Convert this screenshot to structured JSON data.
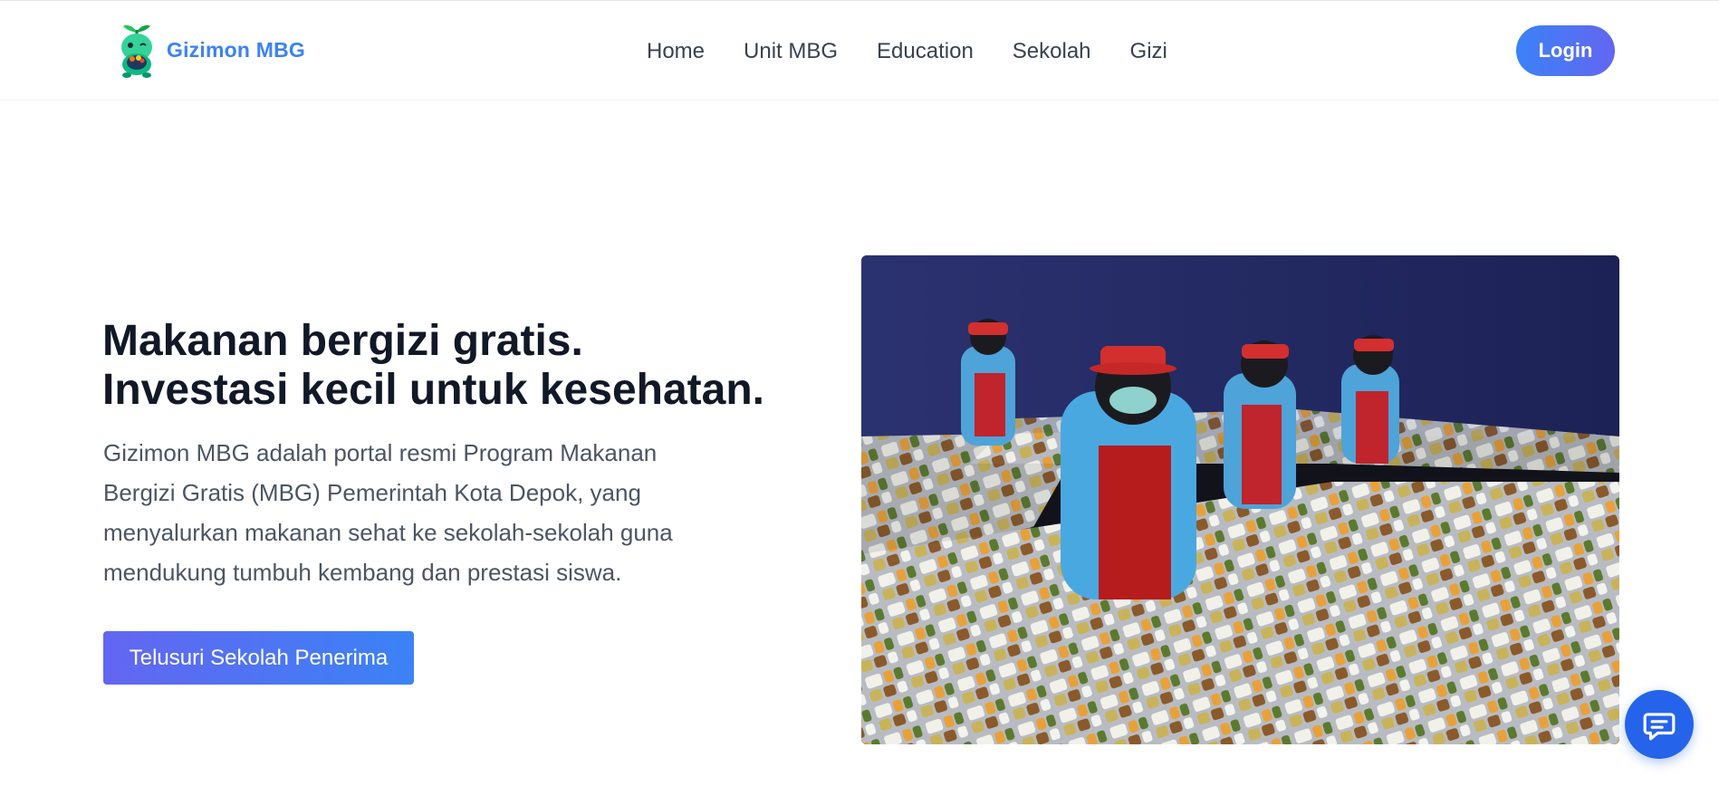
{
  "brand": {
    "name": "Gizimon MBG",
    "logo_icon": "gizimon-mascot-icon"
  },
  "nav": {
    "items": [
      "Home",
      "Unit MBG",
      "Education",
      "Sekolah",
      "Gizi"
    ],
    "login_label": "Login"
  },
  "hero": {
    "title_line1": "Makanan bergizi gratis.",
    "title_line2": "Investasi kecil untuk kesehatan.",
    "description": "Gizimon MBG adalah portal resmi Program Makanan Bergizi Gratis (MBG) Pemerintah Kota Depok, yang menyalurkan makanan sehat ke sekolah-sekolah guna mendukung tumbuh kembang dan prestasi siswa.",
    "cta_label": "Telusuri Sekolah Penerima",
    "image_icon": "kitchen-staff-photo"
  },
  "chat": {
    "icon": "chat-bubble-icon"
  },
  "colors": {
    "brand_blue": "#3b82f6",
    "indigo": "#6366f1",
    "title": "#111827",
    "body_text": "#4b5563",
    "nav_text": "#374151",
    "chat_fab": "#2563eb"
  }
}
